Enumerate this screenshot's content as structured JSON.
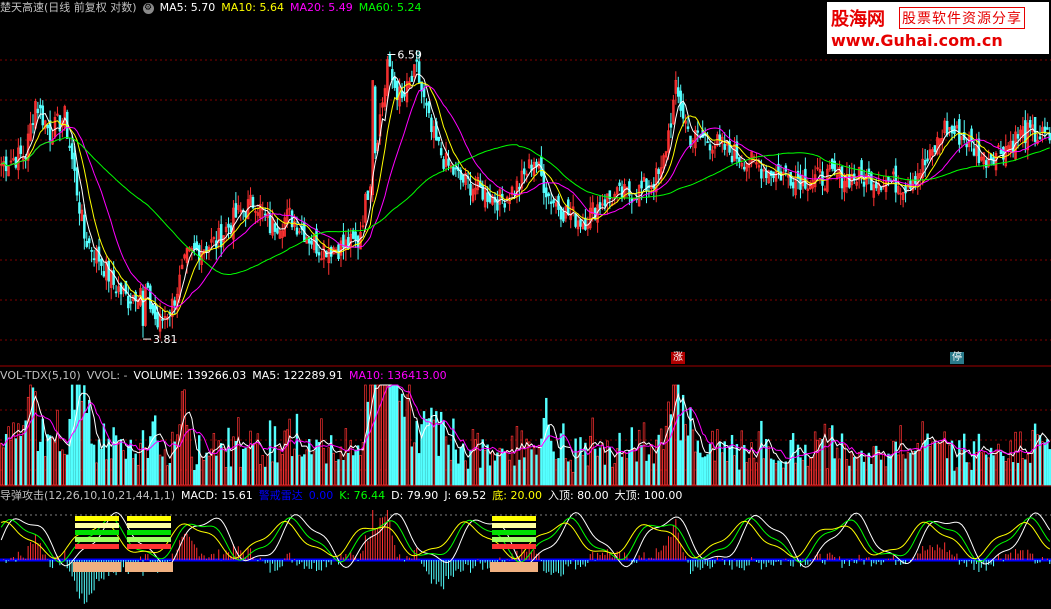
{
  "stock_title": "楚天高速(日线 前复权 对数)",
  "ma_legend": [
    {
      "label": "MA5: 5.70",
      "color": "#ffffff"
    },
    {
      "label": "MA10: 5.64",
      "color": "#ffff00"
    },
    {
      "label": "MA20: 5.49",
      "color": "#ff00ff"
    },
    {
      "label": "MA60: 5.24",
      "color": "#00ff00"
    }
  ],
  "vol_legend": [
    {
      "label": "VOL-TDX(5,10)",
      "color": "#c0c0c0"
    },
    {
      "label": "VVOL: -",
      "color": "#c0c0c0"
    },
    {
      "label": "VOLUME: 139266.03",
      "color": "#ffffff"
    },
    {
      "label": "MA5: 122289.91",
      "color": "#ffffff"
    },
    {
      "label": "MA10: 136413.00",
      "color": "#ff00ff"
    }
  ],
  "ind_legend": [
    {
      "label": "导弹攻击(12,26,10,10,21,44,1,1)",
      "color": "#c0c0c0"
    },
    {
      "label": "MACD: 15.61",
      "color": "#ffffff"
    },
    {
      "label": "警戒雷达",
      "color": "#0000ff"
    },
    {
      "label": "0.00",
      "color": "#0000ff"
    },
    {
      "label": "K: 76.44",
      "color": "#00ff00"
    },
    {
      "label": "D: 79.90",
      "color": "#ffffff"
    },
    {
      "label": "J: 69.52",
      "color": "#ffffff"
    },
    {
      "label": "底: 20.00",
      "color": "#ffff00"
    },
    {
      "label": "入顶: 80.00",
      "color": "#ffffff"
    },
    {
      "label": "大顶: 100.00",
      "color": "#ffffff"
    }
  ],
  "logo": {
    "name": "股海网",
    "tagline": "股票软件资源分享",
    "url": "www.Guhai.com.cn"
  },
  "marks": {
    "zhang": "涨",
    "ting": "停"
  },
  "colors": {
    "up": "#ff3232",
    "down": "#54ffff",
    "grid": "#800000",
    "ma5": "#ffffff",
    "ma10": "#ffff00",
    "ma20": "#ff00ff",
    "ma60": "#00ff00"
  },
  "chart_data": {
    "type": "candlestick",
    "price_high_label": "6.59",
    "price_low_label": "3.81",
    "price_range": [
      3.6,
      6.9
    ],
    "close_anchors": [
      [
        0,
        5.5
      ],
      [
        10,
        5.6
      ],
      [
        14,
        6.1
      ],
      [
        20,
        5.8
      ],
      [
        26,
        5.95
      ],
      [
        30,
        5.4
      ],
      [
        34,
        4.8
      ],
      [
        40,
        4.6
      ],
      [
        46,
        4.35
      ],
      [
        52,
        4.2
      ],
      [
        58,
        4.35
      ],
      [
        64,
        3.95
      ],
      [
        70,
        4.15
      ],
      [
        76,
        4.6
      ],
      [
        82,
        4.7
      ],
      [
        88,
        4.75
      ],
      [
        96,
        5.0
      ],
      [
        104,
        5.15
      ],
      [
        110,
        4.9
      ],
      [
        118,
        5.0
      ],
      [
        124,
        4.85
      ],
      [
        130,
        4.7
      ],
      [
        138,
        4.7
      ],
      [
        146,
        4.75
      ],
      [
        152,
        5.5
      ],
      [
        158,
        6.4
      ],
      [
        164,
        6.1
      ],
      [
        170,
        6.4
      ],
      [
        176,
        5.8
      ],
      [
        182,
        5.5
      ],
      [
        188,
        5.35
      ],
      [
        196,
        5.25
      ],
      [
        204,
        5.15
      ],
      [
        212,
        5.3
      ],
      [
        218,
        5.55
      ],
      [
        224,
        5.2
      ],
      [
        230,
        5.05
      ],
      [
        238,
        4.95
      ],
      [
        246,
        5.15
      ],
      [
        254,
        5.2
      ],
      [
        262,
        5.25
      ],
      [
        270,
        5.4
      ],
      [
        276,
        6.2
      ],
      [
        282,
        5.75
      ],
      [
        288,
        5.75
      ],
      [
        296,
        5.65
      ],
      [
        304,
        5.55
      ],
      [
        312,
        5.45
      ],
      [
        320,
        5.4
      ],
      [
        330,
        5.35
      ],
      [
        340,
        5.38
      ],
      [
        350,
        5.37
      ],
      [
        360,
        5.35
      ],
      [
        370,
        5.3
      ],
      [
        380,
        5.55
      ],
      [
        386,
        5.85
      ],
      [
        394,
        5.75
      ],
      [
        402,
        5.55
      ],
      [
        410,
        5.65
      ],
      [
        418,
        5.8
      ],
      [
        428,
        5.75
      ]
    ],
    "macd_columns_note": "red above zero, cyan below zero"
  }
}
